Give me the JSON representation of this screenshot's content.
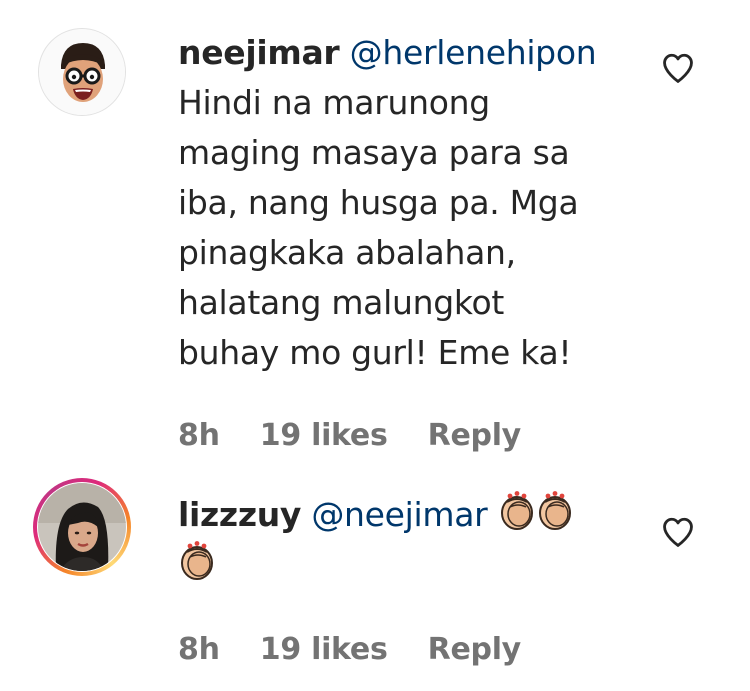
{
  "comments": [
    {
      "username": "neejimar",
      "mention": "@herlenehipon",
      "text": "Hindi na marunong maging masaya para sa iba, nang husga pa. Mga pinagkaka abalahan, halatang malungkot buhay mo gurl! Eme ka!",
      "text_lines": [
        "Hindi na marunong",
        "maging masaya para sa",
        "iba, nang husga pa. Mga",
        "pinagkaka abalahan,",
        "halatang malungkot",
        "buhay mo gurl! Eme ka!"
      ],
      "time": "8h",
      "likes": "19 likes",
      "reply_label": "Reply",
      "avatar_icon": "memoji-glasses-avatar",
      "like_icon": "heart-outline-icon"
    },
    {
      "username": "lizzzuy",
      "mention": "@neejimar",
      "emojis": [
        "clapping-hands-emoji",
        "clapping-hands-emoji",
        "clapping-hands-emoji"
      ],
      "time": "8h",
      "likes": "19 likes",
      "reply_label": "Reply",
      "avatar_icon": "profile-photo-avatar",
      "has_story_ring": true,
      "like_icon": "heart-outline-icon"
    }
  ],
  "colors": {
    "text": "#262626",
    "mention": "#00376b",
    "meta": "#737373",
    "story_ring": [
      "#f58529",
      "#dd2a7b",
      "#feda77"
    ]
  }
}
